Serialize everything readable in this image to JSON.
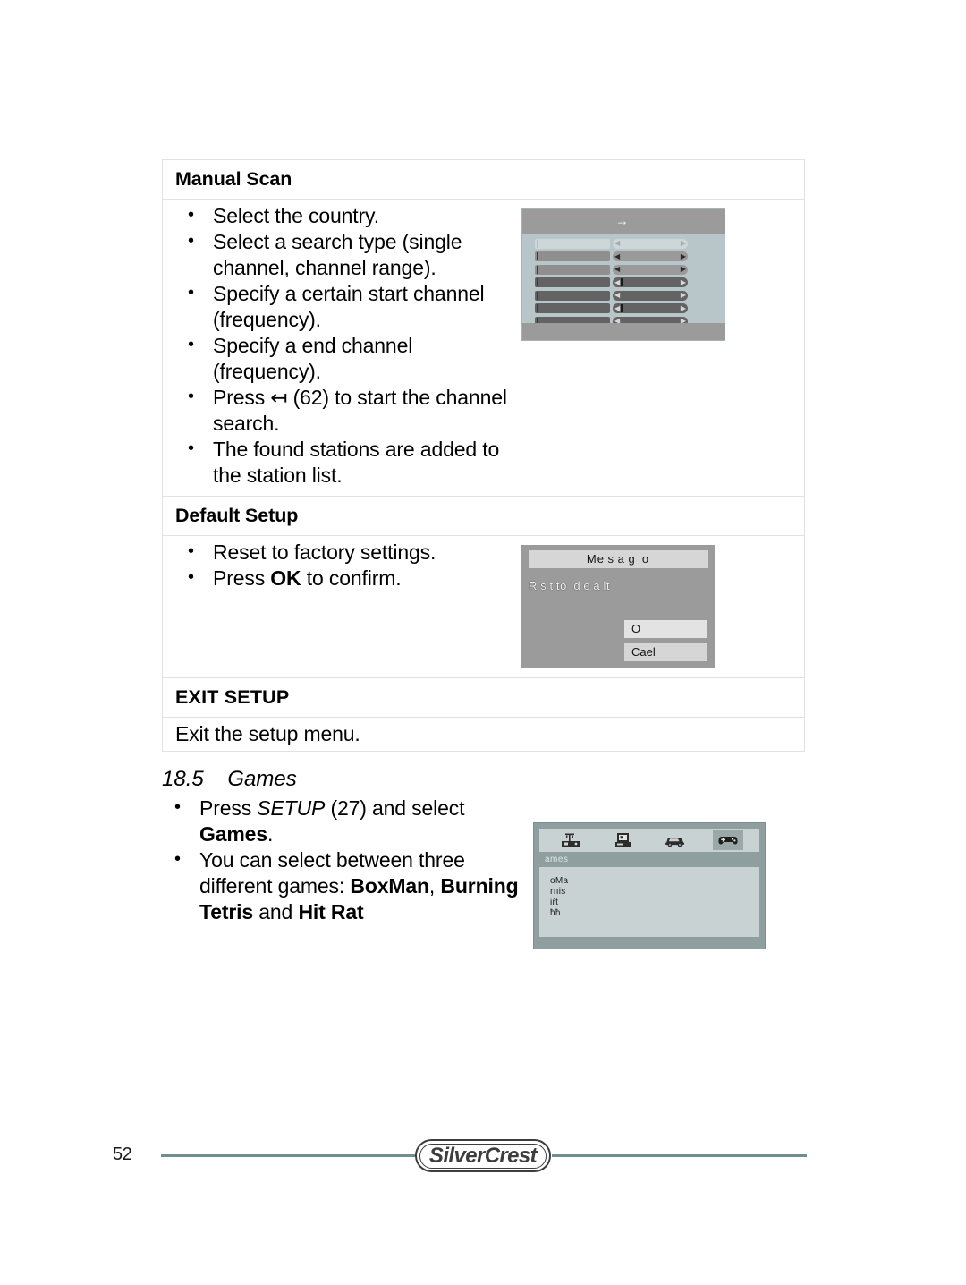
{
  "document": {
    "page_number": "52",
    "brand": "SilverCrest"
  },
  "table": {
    "sections": [
      {
        "title": "Manual Scan",
        "bullets": [
          "Select the country.",
          "Select a search type (single channel, channel range).",
          "Specify a certain start channel (frequency).",
          "Specify a end channel (frequency).",
          "Press ↤ (62) to start the channel search.",
          "The found stations are added to the station list."
        ]
      },
      {
        "title": "Default Setup",
        "bullets": [
          "Reset to factory settings.",
          "Press OK to confirm."
        ]
      },
      {
        "title": "EXIT SETUP",
        "line": "Exit the setup menu."
      }
    ]
  },
  "manual_scan_osd": {
    "arrow": "→",
    "rows": [
      {
        "style": "dim",
        "tick": false
      },
      {
        "style": "mid",
        "tick": false
      },
      {
        "style": "mid",
        "tick": false
      },
      {
        "style": "dark",
        "tick": true
      },
      {
        "style": "dark",
        "tick": false
      },
      {
        "style": "dark",
        "tick": true
      },
      {
        "style": "dark",
        "tick": false
      },
      {
        "style": "dim",
        "tick": false
      }
    ]
  },
  "message_osd": {
    "title": "Me s a g  o",
    "body": "R s t to  d e a lt",
    "buttons": [
      {
        "label": "O",
        "selected": true
      },
      {
        "label": "Cael",
        "selected": false
      }
    ]
  },
  "games_section": {
    "number": "18.5",
    "heading": "Games",
    "bullets": [
      {
        "parts": [
          "Press ",
          "SETUP",
          " (27) and select ",
          "Games",
          "."
        ]
      },
      {
        "parts": [
          "You can select between three different games: ",
          "BoxMan",
          ", ",
          "Burning Tetris",
          " and ",
          "Hit Rat"
        ]
      }
    ]
  },
  "games_osd": {
    "tabs": [
      {
        "icon": "satellite-receiver-icon",
        "active": false
      },
      {
        "icon": "monitor-icon",
        "active": false
      },
      {
        "icon": "car-icon",
        "active": false
      },
      {
        "icon": "gamepad-icon",
        "active": true
      }
    ],
    "tab_title": "ames",
    "items": [
      "oMa",
      "rııis",
      "iŕt",
      "ħħ"
    ]
  }
}
